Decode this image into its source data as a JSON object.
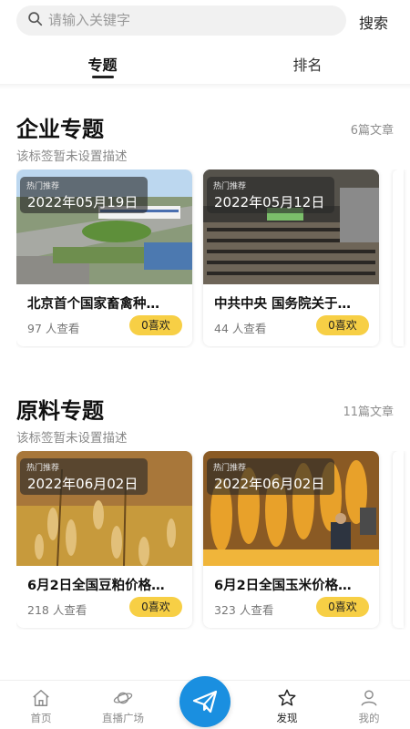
{
  "search": {
    "placeholder": "请输入关键字",
    "button_label": "搜索"
  },
  "tabs": [
    {
      "label": "专题",
      "active": true
    },
    {
      "label": "排名",
      "active": false
    }
  ],
  "sections": [
    {
      "title": "企业专题",
      "count": "6篇文章",
      "description": "该标签暂未设置描述",
      "cards": [
        {
          "tag": "热门推荐",
          "date": "2022年05月19日",
          "title": "北京首个国家畜禽种…",
          "views": "97 人查看",
          "like": "0喜欢"
        },
        {
          "tag": "热门推荐",
          "date": "2022年05月12日",
          "title": "中共中央 国务院关于…",
          "views": "44 人查看",
          "like": "0喜欢"
        }
      ]
    },
    {
      "title": "原料专题",
      "count": "11篇文章",
      "description": "该标签暂未设置描述",
      "cards": [
        {
          "tag": "热门推荐",
          "date": "2022年06月02日",
          "title": "6月2日全国豆粕价格…",
          "views": "218 人查看",
          "like": "0喜欢"
        },
        {
          "tag": "热门推荐",
          "date": "2022年06月02日",
          "title": "6月2日全国玉米价格…",
          "views": "323 人查看",
          "like": "0喜欢"
        }
      ]
    }
  ],
  "third_section_title": "",
  "bottom_nav": [
    {
      "label": "首页",
      "icon": "home-icon",
      "active": false
    },
    {
      "label": "直播广场",
      "icon": "planet-icon",
      "active": false
    },
    {
      "label": "",
      "icon": "paper-plane-icon",
      "active": false
    },
    {
      "label": "发现",
      "icon": "star-icon",
      "active": true
    },
    {
      "label": "我的",
      "icon": "user-icon",
      "active": false
    }
  ],
  "colors": {
    "accent_blue": "#1a8fe0",
    "like_yellow": "#f7cf45",
    "text_primary": "#111111",
    "text_muted": "#888888"
  }
}
